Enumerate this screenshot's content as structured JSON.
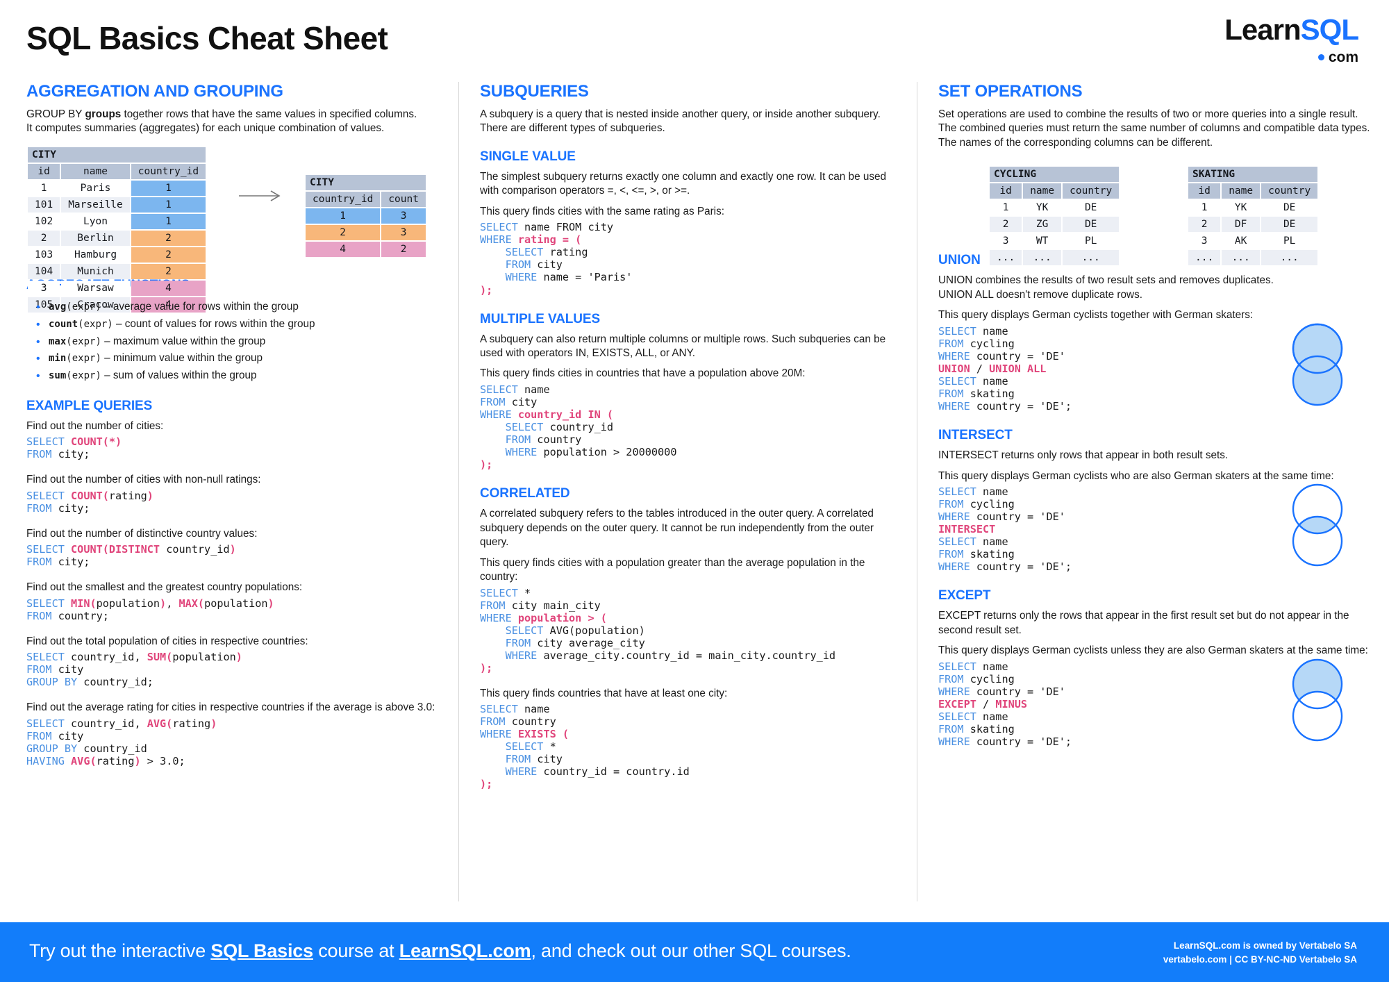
{
  "header": {
    "title": "SQL Basics Cheat Sheet",
    "logo": {
      "learn": "Learn",
      "sql": "SQL",
      "com": "com"
    }
  },
  "colors": {
    "accent_blue": "#1a73ff",
    "keyword_blue": "#4a90e2",
    "function_pink": "#e0457b",
    "table_header": "#b7c3d6",
    "row_alt": "#eceff5",
    "highlight_blue": "#7cb6ef",
    "highlight_orange": "#f8b77a",
    "highlight_pink": "#e8a3c6",
    "footer_blue": "#127dfa"
  },
  "aggregation": {
    "heading": "AGGREGATION AND GROUPING",
    "intro_1_pre": "GROUP  BY ",
    "intro_1_bold": "groups",
    "intro_1_post": " together rows that have the same values in specified columns.",
    "intro_2": "It computes summaries (aggregates) for each unique combination of values.",
    "source_table": {
      "name": "CITY",
      "columns": [
        "id",
        "name",
        "country_id"
      ],
      "rows": [
        {
          "id": "1",
          "name": "Paris",
          "country_id": "1",
          "color": "blue"
        },
        {
          "id": "101",
          "name": "Marseille",
          "country_id": "1",
          "color": "blue"
        },
        {
          "id": "102",
          "name": "Lyon",
          "country_id": "1",
          "color": "blue"
        },
        {
          "id": "2",
          "name": "Berlin",
          "country_id": "2",
          "color": "orange"
        },
        {
          "id": "103",
          "name": "Hamburg",
          "country_id": "2",
          "color": "orange"
        },
        {
          "id": "104",
          "name": "Munich",
          "country_id": "2",
          "color": "orange"
        },
        {
          "id": "3",
          "name": "Warsaw",
          "country_id": "4",
          "color": "pink"
        },
        {
          "id": "105",
          "name": "Cracow",
          "country_id": "4",
          "color": "pink"
        }
      ]
    },
    "result_table": {
      "name": "CITY",
      "columns": [
        "country_id",
        "count"
      ],
      "rows": [
        {
          "country_id": "1",
          "count": "3",
          "color": "blue"
        },
        {
          "country_id": "2",
          "count": "3",
          "color": "orange"
        },
        {
          "country_id": "4",
          "count": "2",
          "color": "pink"
        }
      ]
    },
    "aggregate_functions": {
      "heading": "AGGREGATE FUNCTIONS",
      "items": [
        {
          "fn": "avg",
          "arg": "(expr)",
          "desc": " – average value for rows within the group"
        },
        {
          "fn": "count",
          "arg": "(expr)",
          "desc": " – count of values for rows within the group"
        },
        {
          "fn": "max",
          "arg": "(expr)",
          "desc": " – maximum value within the group"
        },
        {
          "fn": "min",
          "arg": "(expr)",
          "desc": " – minimum value within the group"
        },
        {
          "fn": "sum",
          "arg": "(expr)",
          "desc": " – sum of values within the group"
        }
      ]
    },
    "example_queries": {
      "heading": "EXAMPLE QUERIES",
      "items": [
        {
          "caption": "Find out the number of cities:"
        },
        {
          "caption": "Find out the number of cities with non-null ratings:"
        },
        {
          "caption": "Find out the number of distinctive country values:"
        },
        {
          "caption": "Find out the smallest and the greatest country populations:"
        },
        {
          "caption": "Find out the total population of cities in respective countries:"
        },
        {
          "caption": "Find out the average rating for cities in respective countries if the average is above 3.0:"
        }
      ]
    }
  },
  "subqueries": {
    "heading": "SUBQUERIES",
    "intro": "A subquery is a query that is nested inside another query, or inside another subquery. There are different types of subqueries.",
    "single_value": {
      "heading": "SINGLE VALUE",
      "desc": "The simplest subquery returns exactly one column and exactly one row. It can be used with comparison operators =, <, <=, >, or >=.",
      "caption": "This query finds cities with the same rating as Paris:"
    },
    "multiple_values": {
      "heading": "MULTIPLE VALUES",
      "desc": "A subquery can also return multiple columns or multiple rows. Such subqueries can be used with operators IN, EXISTS, ALL, or ANY.",
      "caption": "This query finds cities in countries that have a population above 20M:"
    },
    "correlated": {
      "heading": "CORRELATED",
      "desc": "A correlated subquery refers to the tables introduced in the outer query. A correlated subquery depends on the outer query. It cannot be run independently from the outer query.",
      "caption_1": "This query finds cities with a population greater than the average population in the country:",
      "caption_2": "This query finds countries that have at least one city:"
    }
  },
  "set_operations": {
    "heading": "SET OPERATIONS",
    "intro": "Set operations are used to combine the results of two or more queries into a single result. The combined queries must return the same number of columns and compatible data types. The names of the corresponding columns can be different.",
    "cycling_table": {
      "name": "CYCLING",
      "columns": [
        "id",
        "name",
        "country"
      ],
      "rows": [
        [
          "1",
          "YK",
          "DE"
        ],
        [
          "2",
          "ZG",
          "DE"
        ],
        [
          "3",
          "WT",
          "PL"
        ],
        [
          "...",
          "...",
          "..."
        ]
      ]
    },
    "skating_table": {
      "name": "SKATING",
      "columns": [
        "id",
        "name",
        "country"
      ],
      "rows": [
        [
          "1",
          "YK",
          "DE"
        ],
        [
          "2",
          "DF",
          "DE"
        ],
        [
          "3",
          "AK",
          "PL"
        ],
        [
          "...",
          "...",
          "..."
        ]
      ]
    },
    "union": {
      "heading": "UNION",
      "desc_1": "UNION combines the results of two result sets and removes duplicates.",
      "desc_2": "UNION  ALL doesn't remove duplicate rows.",
      "caption": "This query displays German cyclists together with German skaters:"
    },
    "intersect": {
      "heading": "INTERSECT",
      "desc": "INTERSECT returns only rows that appear in both result sets.",
      "caption": "This query displays German cyclists who are also German skaters at the same time:"
    },
    "except": {
      "heading": "EXCEPT",
      "desc": "EXCEPT returns only the rows that appear in the first result set but do not appear in the second result set.",
      "caption": "This query displays German cyclists unless they are also German skaters at the same time:"
    }
  },
  "footer": {
    "pre": "Try out the interactive ",
    "link_1": "SQL Basics",
    "mid": " course at ",
    "link_2": "LearnSQL.com",
    "post": ", and check out our other SQL courses.",
    "credit_1": "LearnSQL.com is owned by Vertabelo SA",
    "credit_2": "vertabelo.com | CC BY-NC-ND Vertabelo SA"
  }
}
